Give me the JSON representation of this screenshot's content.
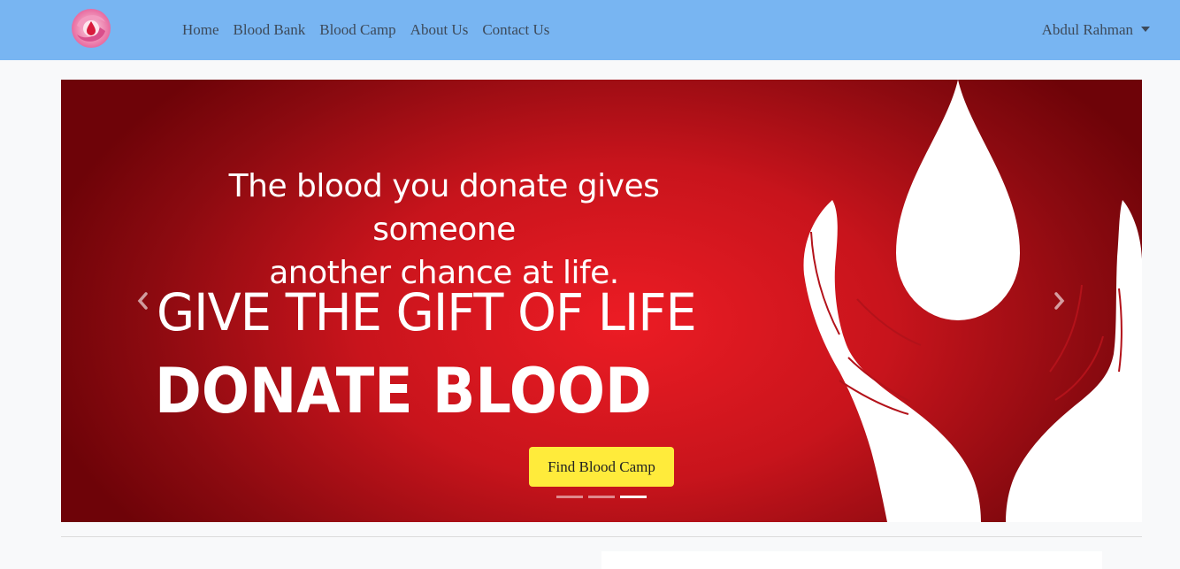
{
  "nav": {
    "links": [
      {
        "label": "Home"
      },
      {
        "label": "Blood Bank"
      },
      {
        "label": "Blood Camp"
      },
      {
        "label": "About Us"
      },
      {
        "label": "Contact Us"
      }
    ],
    "user_name": "Abdul Rahman"
  },
  "carousel": {
    "slide_line_1": "The blood you donate gives someone",
    "slide_line_2": "another chance at life.",
    "slide_headline_1": "GIVE THE GIFT OF LIFE",
    "slide_headline_2": "DONATE BLOOD",
    "cta_label": "Find Blood Camp",
    "indicator_count": 3,
    "active_indicator": 2
  },
  "colors": {
    "navbar": "#78b5f2",
    "banner_red": "#ec1c24",
    "cta_yellow": "#ffeb3b"
  },
  "icons": {
    "logo": "blood-drop-logo-icon",
    "prev": "chevron-left-icon",
    "next": "chevron-right-icon",
    "dropdown": "caret-down-icon"
  }
}
